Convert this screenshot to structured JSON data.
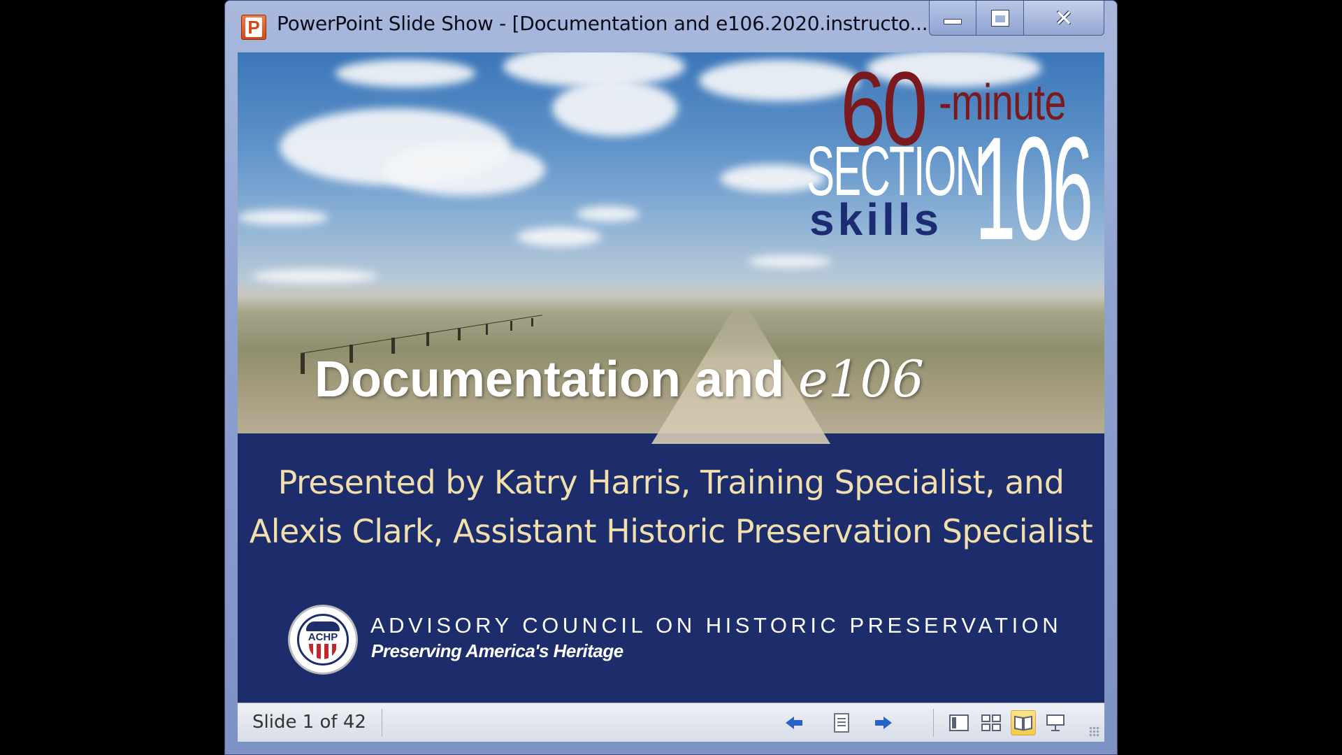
{
  "window": {
    "app_icon_letter": "P",
    "title": "PowerPoint Slide Show - [Documentation and e106.2020.instructo...",
    "controls": {
      "minimize": "",
      "maximize": "",
      "close": "✕"
    }
  },
  "slide": {
    "brand": {
      "number": "60",
      "minute": "-minute",
      "section": "SECTION",
      "code": "106",
      "skills": "skills"
    },
    "title_main": "Documentation and",
    "title_em": "e106",
    "presenter_line1": "Presented by Katry Harris, Training Specialist, and",
    "presenter_line2": "Alexis Clark, Assistant Historic Preservation Specialist",
    "org": {
      "seal_text": "ACHP",
      "name": "ADVISORY COUNCIL ON HISTORIC PRESERVATION",
      "tagline": "Preserving America's Heritage"
    }
  },
  "statusbar": {
    "slide_indicator": "Slide 1 of 42",
    "icons": [
      "previous-arrow-icon",
      "menu-icon",
      "next-arrow-icon",
      "normal-view-icon",
      "slide-sorter-icon",
      "reading-view-icon",
      "slide-show-icon"
    ],
    "active_view": "reading-view"
  },
  "colors": {
    "slide_blue": "#1d2d6b",
    "brand_red": "#7a1a1f",
    "presenter_gold": "#f1dfae",
    "nav_arrow_blue": "#2a63c8"
  }
}
